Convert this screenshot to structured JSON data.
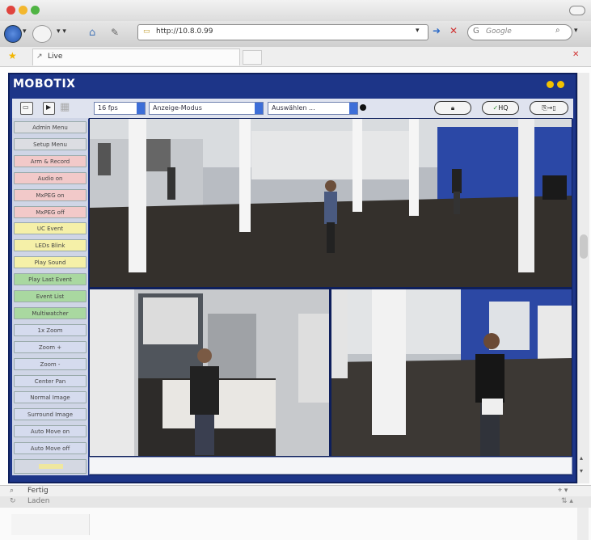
{
  "browser": {
    "url": "http://10.8.0.99",
    "search_placeholder": "Google",
    "tab_title": "Live"
  },
  "app": {
    "logo": "MOBOTIX",
    "toolbar": {
      "fps_select": "16 fps",
      "display_mode_select": "Anzeige-Modus",
      "select_placeholder": "Auswählen ...",
      "hq_label": "HQ"
    },
    "menu": [
      {
        "label": "Admin Menu",
        "style": "gray"
      },
      {
        "label": "Setup Menu",
        "style": "gray"
      },
      {
        "label": "Arm & Record",
        "style": "pink"
      },
      {
        "label": "Audio on",
        "style": "pink"
      },
      {
        "label": "MxPEG on",
        "style": "pink"
      },
      {
        "label": "MxPEG off",
        "style": "pink"
      },
      {
        "label": "UC Event",
        "style": "yellow"
      },
      {
        "label": "LEDs Blink",
        "style": "yellow"
      },
      {
        "label": "Play Sound",
        "style": "yellow"
      },
      {
        "label": "Play Last Event",
        "style": "green"
      },
      {
        "label": "Event List",
        "style": "green"
      },
      {
        "label": "Multiwatcher",
        "style": "green"
      },
      {
        "label": "1x Zoom",
        "style": "blue"
      },
      {
        "label": "Zoom +",
        "style": "blue"
      },
      {
        "label": "Zoom -",
        "style": "blue"
      },
      {
        "label": "Center Pan",
        "style": "blue"
      },
      {
        "label": "Normal Image",
        "style": "blue"
      },
      {
        "label": "Surround Image",
        "style": "blue"
      },
      {
        "label": "Auto Move on",
        "style": "blue"
      },
      {
        "label": "Auto Move off",
        "style": "blue"
      }
    ]
  },
  "find_bar": {
    "label": "Fertig"
  },
  "status_bar": {
    "label": "Laden"
  },
  "colors": {
    "header_blue": "#1d3588",
    "accent_yellow": "#f2c200"
  }
}
